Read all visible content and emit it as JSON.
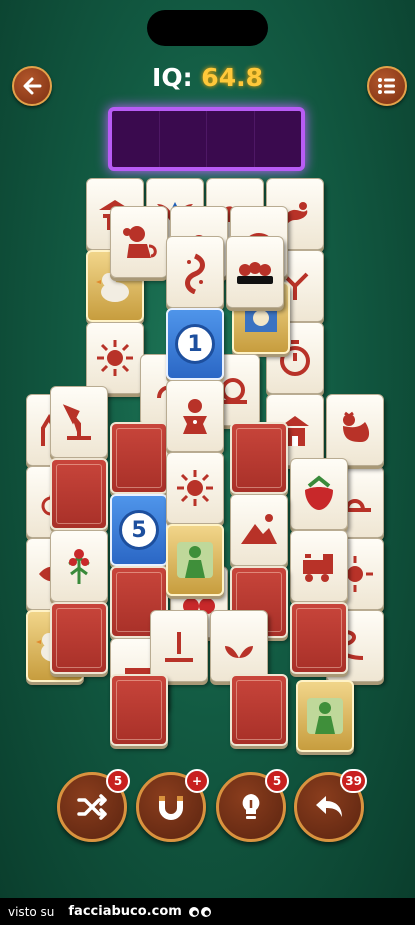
{
  "header": {
    "iq_label": "IQ:",
    "iq_value": "64.8",
    "back_icon": "arrow-left-icon",
    "menu_icon": "list-menu-icon"
  },
  "tray": {
    "slots": 4,
    "filled": 0
  },
  "colors": {
    "tile_red": "#b83228",
    "tray_border": "#b85cf5",
    "iq_value": "#ffc83a",
    "button_ring": "#d9933f"
  },
  "boosters": [
    {
      "name": "shuffle",
      "icon": "shuffle-icon",
      "badge": "5"
    },
    {
      "name": "magnet",
      "icon": "magnet-icon",
      "badge": "+"
    },
    {
      "name": "hint",
      "icon": "lightbulb-icon",
      "badge": "5"
    },
    {
      "name": "undo",
      "icon": "undo-icon",
      "badge": "39"
    }
  ],
  "tiles": [
    {
      "kind": "back"
    },
    {
      "kind": "number",
      "label": "1"
    },
    {
      "kind": "number",
      "label": "5"
    },
    {
      "kind": "symbol",
      "symbol": "monkey"
    },
    {
      "kind": "symbol",
      "symbol": "koi-fish"
    },
    {
      "kind": "symbol",
      "symbol": "dumplings"
    },
    {
      "kind": "symbol",
      "symbol": "sun"
    },
    {
      "kind": "symbol",
      "symbol": "desk-lamp"
    },
    {
      "kind": "symbol",
      "symbol": "gingerbread-man"
    },
    {
      "kind": "symbol",
      "symbol": "rooster"
    },
    {
      "kind": "symbol",
      "symbol": "strawberry"
    },
    {
      "kind": "symbol",
      "symbol": "flower"
    },
    {
      "kind": "symbol",
      "symbol": "mountain"
    },
    {
      "kind": "symbol",
      "symbol": "train"
    },
    {
      "kind": "image",
      "symbol": "green-statue"
    }
  ],
  "footer": {
    "visto_su": "visto su",
    "site": "facciabuco.com"
  }
}
